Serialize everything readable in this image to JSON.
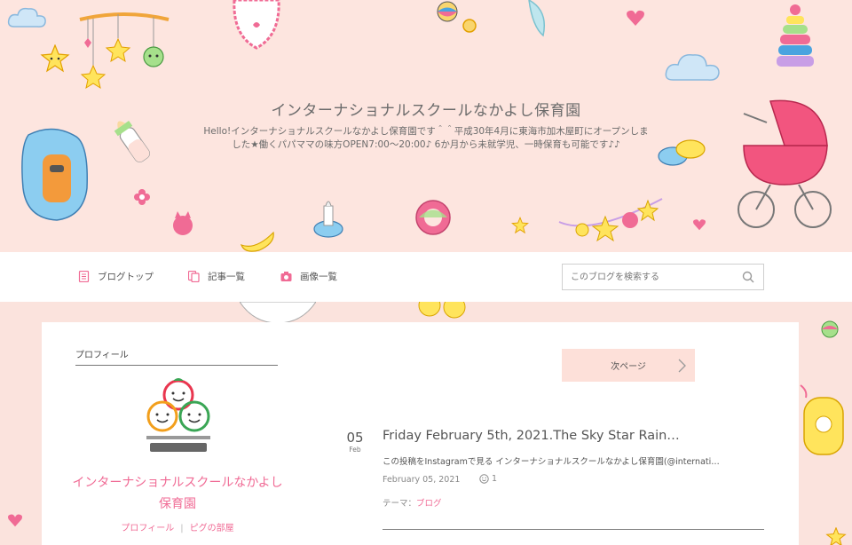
{
  "header": {
    "blog_title": "インターナショナルスクールなかよし保育園",
    "description": "Hello!インターナショナルスクールなかよし保育園です＾＾平成30年4月に東海市加木屋町にオープンしました★働くパパママの味方OPEN7:00〜20:00♪ 6か月から未就学児、一時保育も可能です♪♪"
  },
  "nav": {
    "items": [
      {
        "label": "ブログトップ",
        "icon": "document-icon"
      },
      {
        "label": "記事一覧",
        "icon": "copy-icon"
      },
      {
        "label": "画像一覧",
        "icon": "camera-icon"
      }
    ],
    "search": {
      "placeholder": "このブログを検索する",
      "value": "",
      "icon": "search-icon"
    }
  },
  "sidebar": {
    "heading": "プロフィール",
    "logo_text": "インターナショナルスクール なかよし保育園",
    "profile_name": "インターナショナルスクールなかよし保育園",
    "links": [
      "プロフィール",
      "ピグの部屋"
    ]
  },
  "main": {
    "next_page_label": "次ページ",
    "post": {
      "day": "05",
      "month": "Feb",
      "title": "Friday February 5th, 2021.The Sky Star Rain…",
      "excerpt": "この投稿をInstagramで見る インターナショナルスクールなかよし保育園(@internati…",
      "date": "February 05, 2021",
      "likes": "1",
      "theme_label": "テーマ：",
      "theme_link": "ブログ"
    }
  },
  "colors": {
    "background": "#fbe3dd",
    "accent_pink": "#f06b95",
    "next_button": "#fde0d9"
  }
}
